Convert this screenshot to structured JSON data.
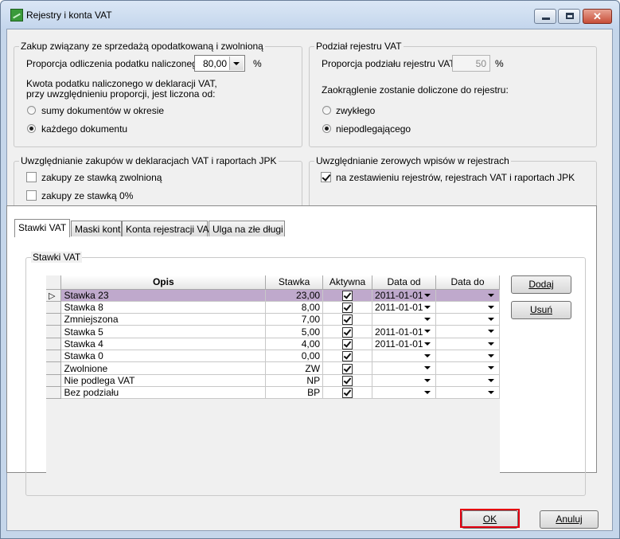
{
  "window": {
    "title": "Rejestry i konta VAT"
  },
  "group_purchase": {
    "title": "Zakup związany ze sprzedażą opodatkowaną i zwolnioną",
    "proportion_label": "Proporcja odliczenia podatku naliczonego:",
    "proportion_value": "80,00",
    "percent": "%",
    "info_line1": "Kwota podatku naliczonego w deklaracji VAT,",
    "info_line2": "przy uwzględnieniu proporcji, jest liczona od:",
    "option_sum": "sumy dokumentów w okresie",
    "option_each": "każdego dokumentu",
    "selected": "każdego dokumentu"
  },
  "group_split": {
    "title": "Podział rejestru VAT",
    "proportion_label": "Proporcja podziału rejestru VAT:",
    "proportion_value": "50",
    "percent": "%",
    "rounding_label": "Zaokrąglenie zostanie doliczone do rejestru:",
    "option_regular": "zwykłego",
    "option_nonsub": "niepodlegającego",
    "selected": "niepodlegającego"
  },
  "group_include_purchases": {
    "title": "Uwzględnianie zakupów w deklaracjach VAT i raportach JPK",
    "option_exempt": "zakupy ze stawką zwolnioną",
    "option_zero": "zakupy ze stawką 0%",
    "exempt_checked": false,
    "zero_checked": false
  },
  "group_zero_entries": {
    "title": "Uwzględnianie zerowych wpisów w rejestrach",
    "option_label": "na zestawieniu rejestrów, rejestrach VAT i raportach JPK",
    "checked": true
  },
  "tabs": [
    {
      "label": "Stawki VAT",
      "active": true
    },
    {
      "label": "Maski kont",
      "active": false
    },
    {
      "label": "Konta rejestracji VAT",
      "active": false
    },
    {
      "label": "Ulga na złe długi",
      "active": false
    }
  ],
  "rates_group": {
    "title": "Stawki VAT"
  },
  "table": {
    "columns": [
      "Opis",
      "Stawka",
      "Aktywna",
      "Data od",
      "Data do"
    ],
    "rows": [
      {
        "opis": "Stawka 23",
        "stawka": "23,00",
        "aktywna": true,
        "data_od": "2011-01-01",
        "data_do": "",
        "selected": true
      },
      {
        "opis": "Stawka 8",
        "stawka": "8,00",
        "aktywna": true,
        "data_od": "2011-01-01",
        "data_do": "",
        "selected": false
      },
      {
        "opis": "Zmniejszona",
        "stawka": "7,00",
        "aktywna": true,
        "data_od": "",
        "data_do": "",
        "selected": false
      },
      {
        "opis": "Stawka 5",
        "stawka": "5,00",
        "aktywna": true,
        "data_od": "2011-01-01",
        "data_do": "",
        "selected": false
      },
      {
        "opis": "Stawka 4",
        "stawka": "4,00",
        "aktywna": true,
        "data_od": "2011-01-01",
        "data_do": "",
        "selected": false
      },
      {
        "opis": "Stawka 0",
        "stawka": "0,00",
        "aktywna": true,
        "data_od": "",
        "data_do": "",
        "selected": false
      },
      {
        "opis": "Zwolnione",
        "stawka": "ZW",
        "aktywna": true,
        "data_od": "",
        "data_do": "",
        "selected": false
      },
      {
        "opis": "Nie podlega VAT",
        "stawka": "NP",
        "aktywna": true,
        "data_od": "",
        "data_do": "",
        "selected": false
      },
      {
        "opis": "Bez podziału",
        "stawka": "BP",
        "aktywna": true,
        "data_od": "",
        "data_do": "",
        "selected": false
      }
    ]
  },
  "buttons": {
    "add": "Dodaj",
    "remove": "Usuń",
    "ok": "OK",
    "cancel": "Anuluj"
  },
  "colors": {
    "selected_row": "#bfa9cc",
    "highlight": "#e3000f"
  }
}
